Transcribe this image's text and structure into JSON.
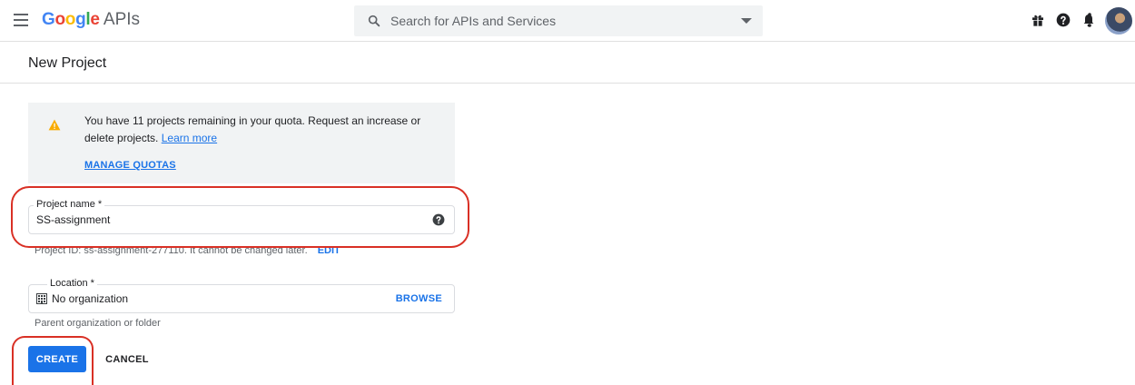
{
  "header": {
    "logo_google_letters": [
      {
        "ch": "G",
        "color": "#4285F4"
      },
      {
        "ch": "o",
        "color": "#EA4335"
      },
      {
        "ch": "o",
        "color": "#FBBC05"
      },
      {
        "ch": "g",
        "color": "#4285F4"
      },
      {
        "ch": "l",
        "color": "#34A853"
      },
      {
        "ch": "e",
        "color": "#EA4335"
      }
    ],
    "logo_suffix": "APIs",
    "search_placeholder": "Search for APIs and Services",
    "icons": [
      "menu-icon",
      "search-icon",
      "gift-icon",
      "help-icon",
      "bell-icon",
      "more-vert-icon",
      "avatar"
    ]
  },
  "page": {
    "title": "New Project"
  },
  "quota": {
    "message": "You have 11 projects remaining in your quota. Request an increase or delete projects.",
    "learn_more": "Learn more",
    "manage_quotas": "MANAGE QUOTAS"
  },
  "project_name": {
    "label": "Project name *",
    "value": "SS-assignment",
    "project_id_text": "Project ID: ss-assignment-277110. It cannot be changed later.",
    "edit_label": "EDIT"
  },
  "location": {
    "label": "Location *",
    "value": "No organization",
    "browse_label": "BROWSE",
    "hint": "Parent organization or folder"
  },
  "actions": {
    "create_label": "CREATE",
    "cancel_label": "CANCEL"
  },
  "colors": {
    "primary": "#1a73e8",
    "warning": "#f9ab00",
    "highlight": "#d93025"
  }
}
